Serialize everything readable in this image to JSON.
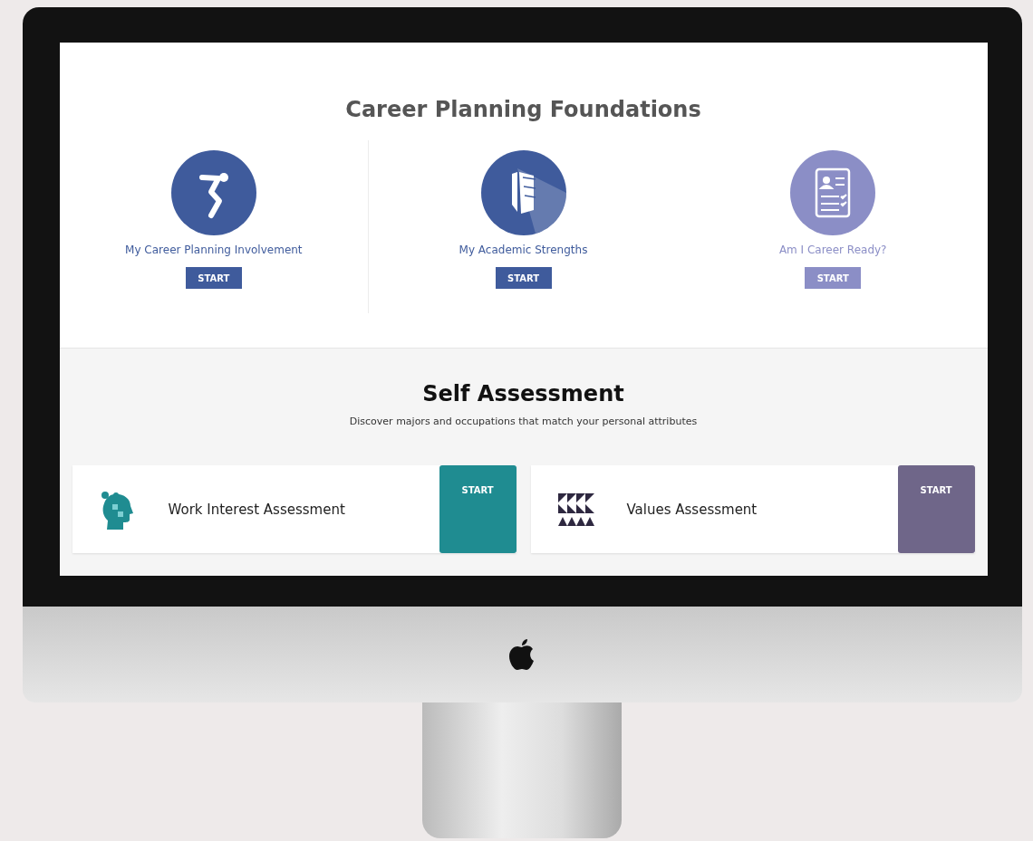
{
  "foundations": {
    "title": "**Career** Planning Foundations",
    "items": [
      {
        "label": "My Career Planning Involvement",
        "button": "START",
        "kind": "jumper",
        "color": "#3f5b9c"
      },
      {
        "label": "My Academic Strengths",
        "button": "START",
        "kind": "book",
        "color": "#3f5b9c"
      },
      {
        "label": "Am I Career Ready?",
        "button": "START",
        "kind": "checklist",
        "color": "#8b8ec6"
      }
    ]
  },
  "self_assessment": {
    "title": "Self Assessment",
    "subtitle": "Discover majors and occupations that match your personal attributes",
    "cards": [
      {
        "label": "Work Interest Assessment",
        "button": "START",
        "kind": "puzzle-head",
        "color": "#1f8c91"
      },
      {
        "label": "Values Assessment",
        "button": "START",
        "kind": "triangles",
        "color": "#6f6689"
      }
    ]
  }
}
